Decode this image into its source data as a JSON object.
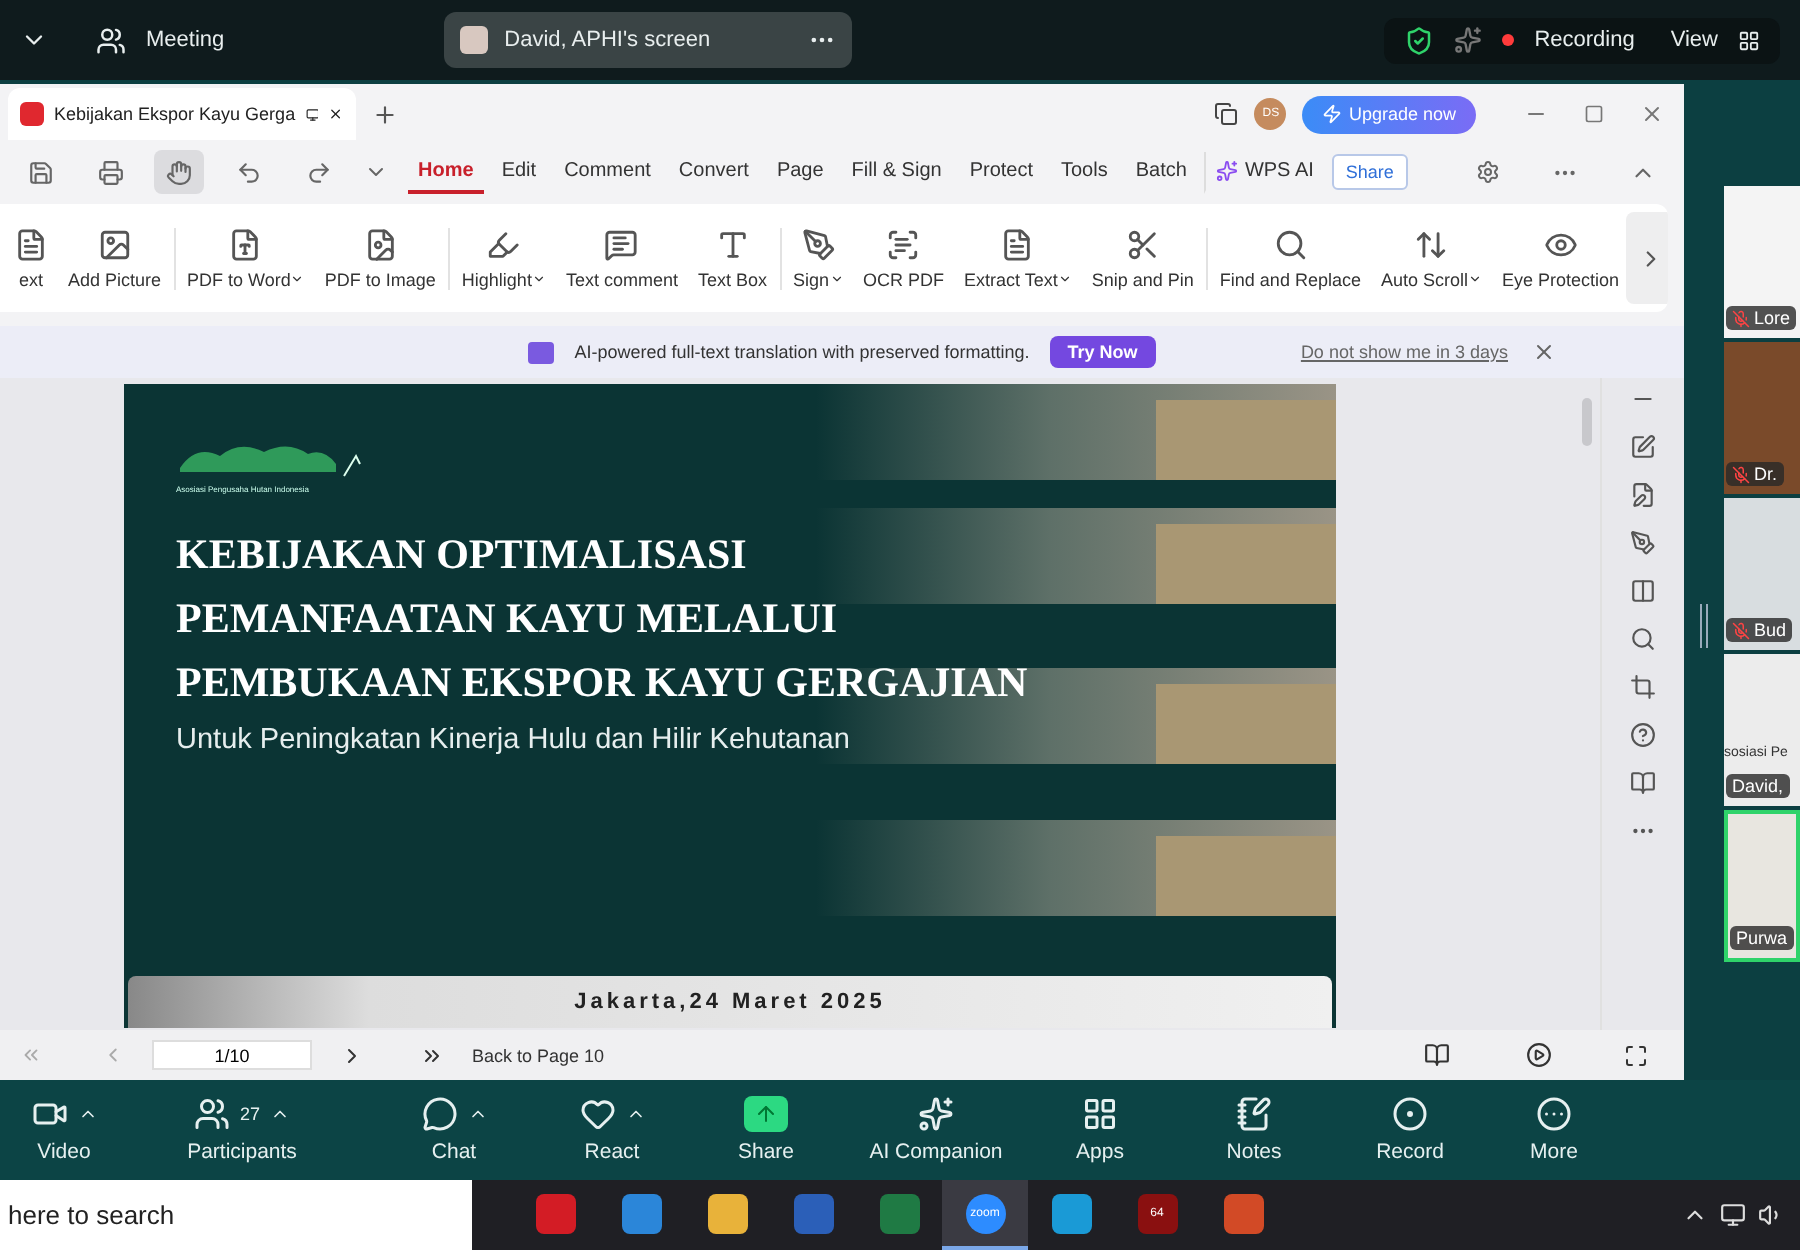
{
  "meeting_bar": {
    "title": "Meeting",
    "share_pill": "David, APHI's screen",
    "recording": "Recording",
    "view": "View"
  },
  "pdf": {
    "tab_title": "Kebijakan Ekspor Kayu Gerga",
    "avatar": "DS",
    "upgrade": "Upgrade now",
    "menu": [
      {
        "label": "Home",
        "selected": true
      },
      {
        "label": "Edit",
        "selected": false
      },
      {
        "label": "Comment",
        "selected": false
      },
      {
        "label": "Convert",
        "selected": false
      },
      {
        "label": "Page",
        "selected": false
      },
      {
        "label": "Fill & Sign",
        "selected": false
      },
      {
        "label": "Protect",
        "selected": false
      },
      {
        "label": "Tools",
        "selected": false
      },
      {
        "label": "Batch",
        "selected": false
      }
    ],
    "wps_ai": "WPS AI",
    "share": "Share",
    "ribbon": [
      {
        "label": "ext",
        "dropdown": false,
        "group_start": false
      },
      {
        "label": "Add Picture",
        "dropdown": false,
        "group_start": false
      },
      {
        "label": "PDF to Word",
        "dropdown": true,
        "group_start": true
      },
      {
        "label": "PDF to Image",
        "dropdown": false,
        "group_start": false
      },
      {
        "label": "Highlight",
        "dropdown": true,
        "group_start": true
      },
      {
        "label": "Text comment",
        "dropdown": false,
        "group_start": false
      },
      {
        "label": "Text Box",
        "dropdown": false,
        "group_start": false
      },
      {
        "label": "Sign",
        "dropdown": true,
        "group_start": true
      },
      {
        "label": "OCR PDF",
        "dropdown": false,
        "group_start": false
      },
      {
        "label": "Extract Text",
        "dropdown": true,
        "group_start": false
      },
      {
        "label": "Snip and Pin",
        "dropdown": false,
        "group_start": false
      },
      {
        "label": "Find and Replace",
        "dropdown": false,
        "group_start": true
      },
      {
        "label": "Auto Scroll",
        "dropdown": true,
        "group_start": false
      },
      {
        "label": "Eye Protection",
        "dropdown": false,
        "group_start": false
      }
    ],
    "banner": {
      "text": "AI-powered full-text translation with preserved formatting.",
      "button": "Try Now",
      "link": "Do not show me in 3 days"
    },
    "slide": {
      "logo_caption": "Asosiasi Pengusaha Hutan Indonesia",
      "title_lines": [
        "KEBIJAKAN OPTIMALISASI",
        "PEMANFAATAN KAYU MELALUI",
        "PEMBUKAAN EKSPOR KAYU GERGAJIAN"
      ],
      "subtitle": "Untuk Peningkatan Kinerja Hulu dan Hilir Kehutanan",
      "date": "Jakarta,24 Maret 2025"
    },
    "nav": {
      "page": "1/10",
      "back": "Back to Page 10"
    }
  },
  "gallery": [
    {
      "name": "Lore",
      "muted": true,
      "active": false,
      "kind": "person"
    },
    {
      "name": "Dr.",
      "muted": true,
      "active": false,
      "kind": "books"
    },
    {
      "name": "Bud",
      "muted": true,
      "active": false,
      "kind": "room"
    },
    {
      "name": "David,",
      "muted": false,
      "active": false,
      "kind": "logo",
      "caption": "sosiasi Pe"
    },
    {
      "name": "Purwa",
      "muted": false,
      "active": true,
      "kind": "blur"
    }
  ],
  "toolbar": [
    {
      "label": "Video",
      "caret": true
    },
    {
      "label": "Participants",
      "caret": true,
      "count": "27"
    },
    {
      "label": "Chat",
      "caret": true
    },
    {
      "label": "React",
      "caret": true
    },
    {
      "label": "Share",
      "caret": false
    },
    {
      "label": "AI Companion",
      "caret": false
    },
    {
      "label": "Apps",
      "caret": false
    },
    {
      "label": "Notes",
      "caret": false
    },
    {
      "label": "Record",
      "caret": false
    },
    {
      "label": "More",
      "caret": false
    }
  ],
  "taskbar": {
    "search": "here to search",
    "apps": [
      {
        "selected": false
      },
      {
        "selected": false
      },
      {
        "selected": false
      },
      {
        "selected": false
      },
      {
        "selected": false
      },
      {
        "selected": true,
        "label": "zoom"
      },
      {
        "selected": false
      },
      {
        "selected": false,
        "badge": "64"
      },
      {
        "selected": false
      }
    ]
  }
}
